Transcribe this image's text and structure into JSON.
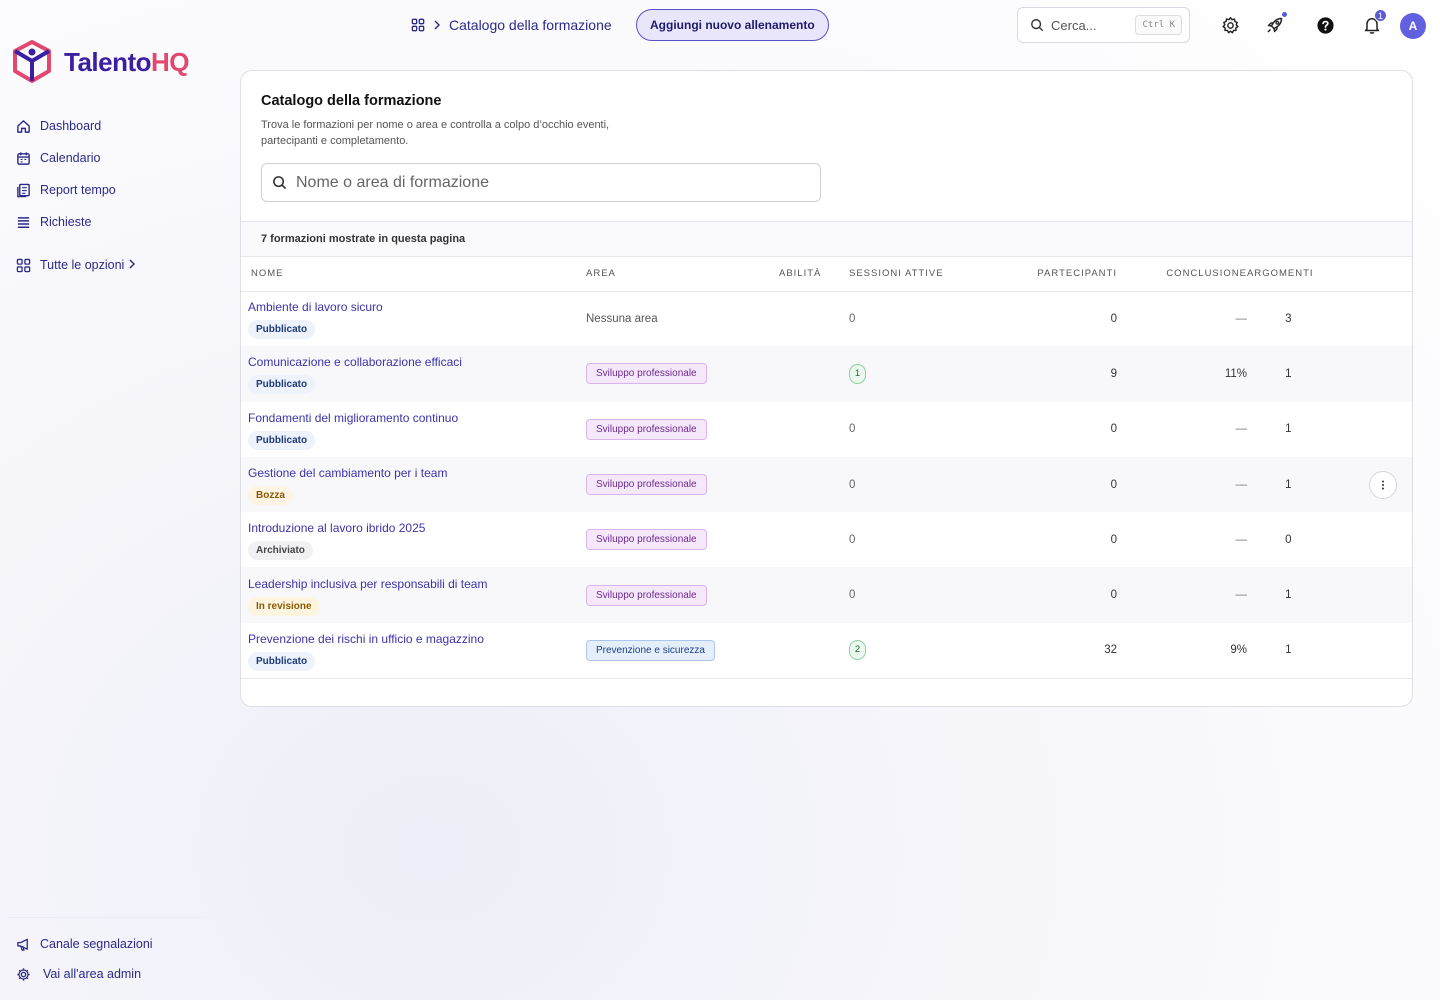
{
  "brand": {
    "name_main": "Talento",
    "name_accent": "HQ",
    "colors": {
      "primary": "#3b1fa3",
      "accent": "#e2476e"
    }
  },
  "sidebar": {
    "items": [
      {
        "label": "Dashboard",
        "icon": "home-icon"
      },
      {
        "label": "Calendario",
        "icon": "calendar-icon"
      },
      {
        "label": "Report tempo",
        "icon": "report-icon"
      },
      {
        "label": "Richieste",
        "icon": "list-icon"
      }
    ],
    "more_label": "Tutte le opzioni",
    "bottom": [
      {
        "label": "Canale segnalazioni",
        "icon": "megaphone-icon"
      },
      {
        "label": "Vai all'area admin",
        "icon": "gear-icon"
      }
    ]
  },
  "header": {
    "breadcrumb_current": "Catalogo della formazione",
    "add_button": "Aggiungi nuovo allenamento",
    "search_placeholder": "Cerca...",
    "search_shortcut": "Ctrl K",
    "notification_count": "1",
    "avatar_initial": "A"
  },
  "catalog": {
    "title": "Catalogo della formazione",
    "description": "Trova le formazioni per nome o area e controlla a colpo d’occhio eventi, partecipanti e completamento.",
    "search_placeholder": "Nome o area di formazione",
    "count_text": "7 formazioni mostrate in questa pagina",
    "columns": {
      "name": "NOME",
      "area": "AREA",
      "skills": "ABILITÀ",
      "sessions": "SESSIONI ATTIVE",
      "participants": "PARTECIPANTI",
      "completion": "CONCLUSIONE",
      "topics": "ARGOMENTI"
    },
    "rows": [
      {
        "name": "Ambiente di lavoro sicuro",
        "status": "Pubblicato",
        "status_type": "pub",
        "area": "Nessuna area",
        "area_type": "none",
        "sessions": "0",
        "participants": "0",
        "completion": "—",
        "topics": "3"
      },
      {
        "name": "Comunicazione e collaborazione efficaci",
        "status": "Pubblicato",
        "status_type": "pub",
        "area": "Sviluppo professionale",
        "area_type": "dev",
        "sessions": "1",
        "participants": "9",
        "completion": "11%",
        "topics": "1"
      },
      {
        "name": "Fondamenti del miglioramento continuo",
        "status": "Pubblicato",
        "status_type": "pub",
        "area": "Sviluppo professionale",
        "area_type": "dev",
        "sessions": "0",
        "participants": "0",
        "completion": "—",
        "topics": "1"
      },
      {
        "name": "Gestione del cambiamento per i team",
        "status": "Bozza",
        "status_type": "draft",
        "area": "Sviluppo professionale",
        "area_type": "dev",
        "sessions": "0",
        "participants": "0",
        "completion": "—",
        "topics": "1"
      },
      {
        "name": "Introduzione al lavoro ibrido 2025",
        "status": "Archiviato",
        "status_type": "arch",
        "area": "Sviluppo professionale",
        "area_type": "dev",
        "sessions": "0",
        "participants": "0",
        "completion": "—",
        "topics": "0"
      },
      {
        "name": "Leadership inclusiva per responsabili di team",
        "status": "In revisione",
        "status_type": "rev",
        "area": "Sviluppo professionale",
        "area_type": "dev",
        "sessions": "0",
        "participants": "0",
        "completion": "—",
        "topics": "1"
      },
      {
        "name": "Prevenzione dei rischi in ufficio e magazzino",
        "status": "Pubblicato",
        "status_type": "pub",
        "area": "Prevenzione e sicurezza",
        "area_type": "safe",
        "sessions": "2",
        "participants": "32",
        "completion": "9%",
        "topics": "1"
      }
    ],
    "kebab_row": 3
  }
}
